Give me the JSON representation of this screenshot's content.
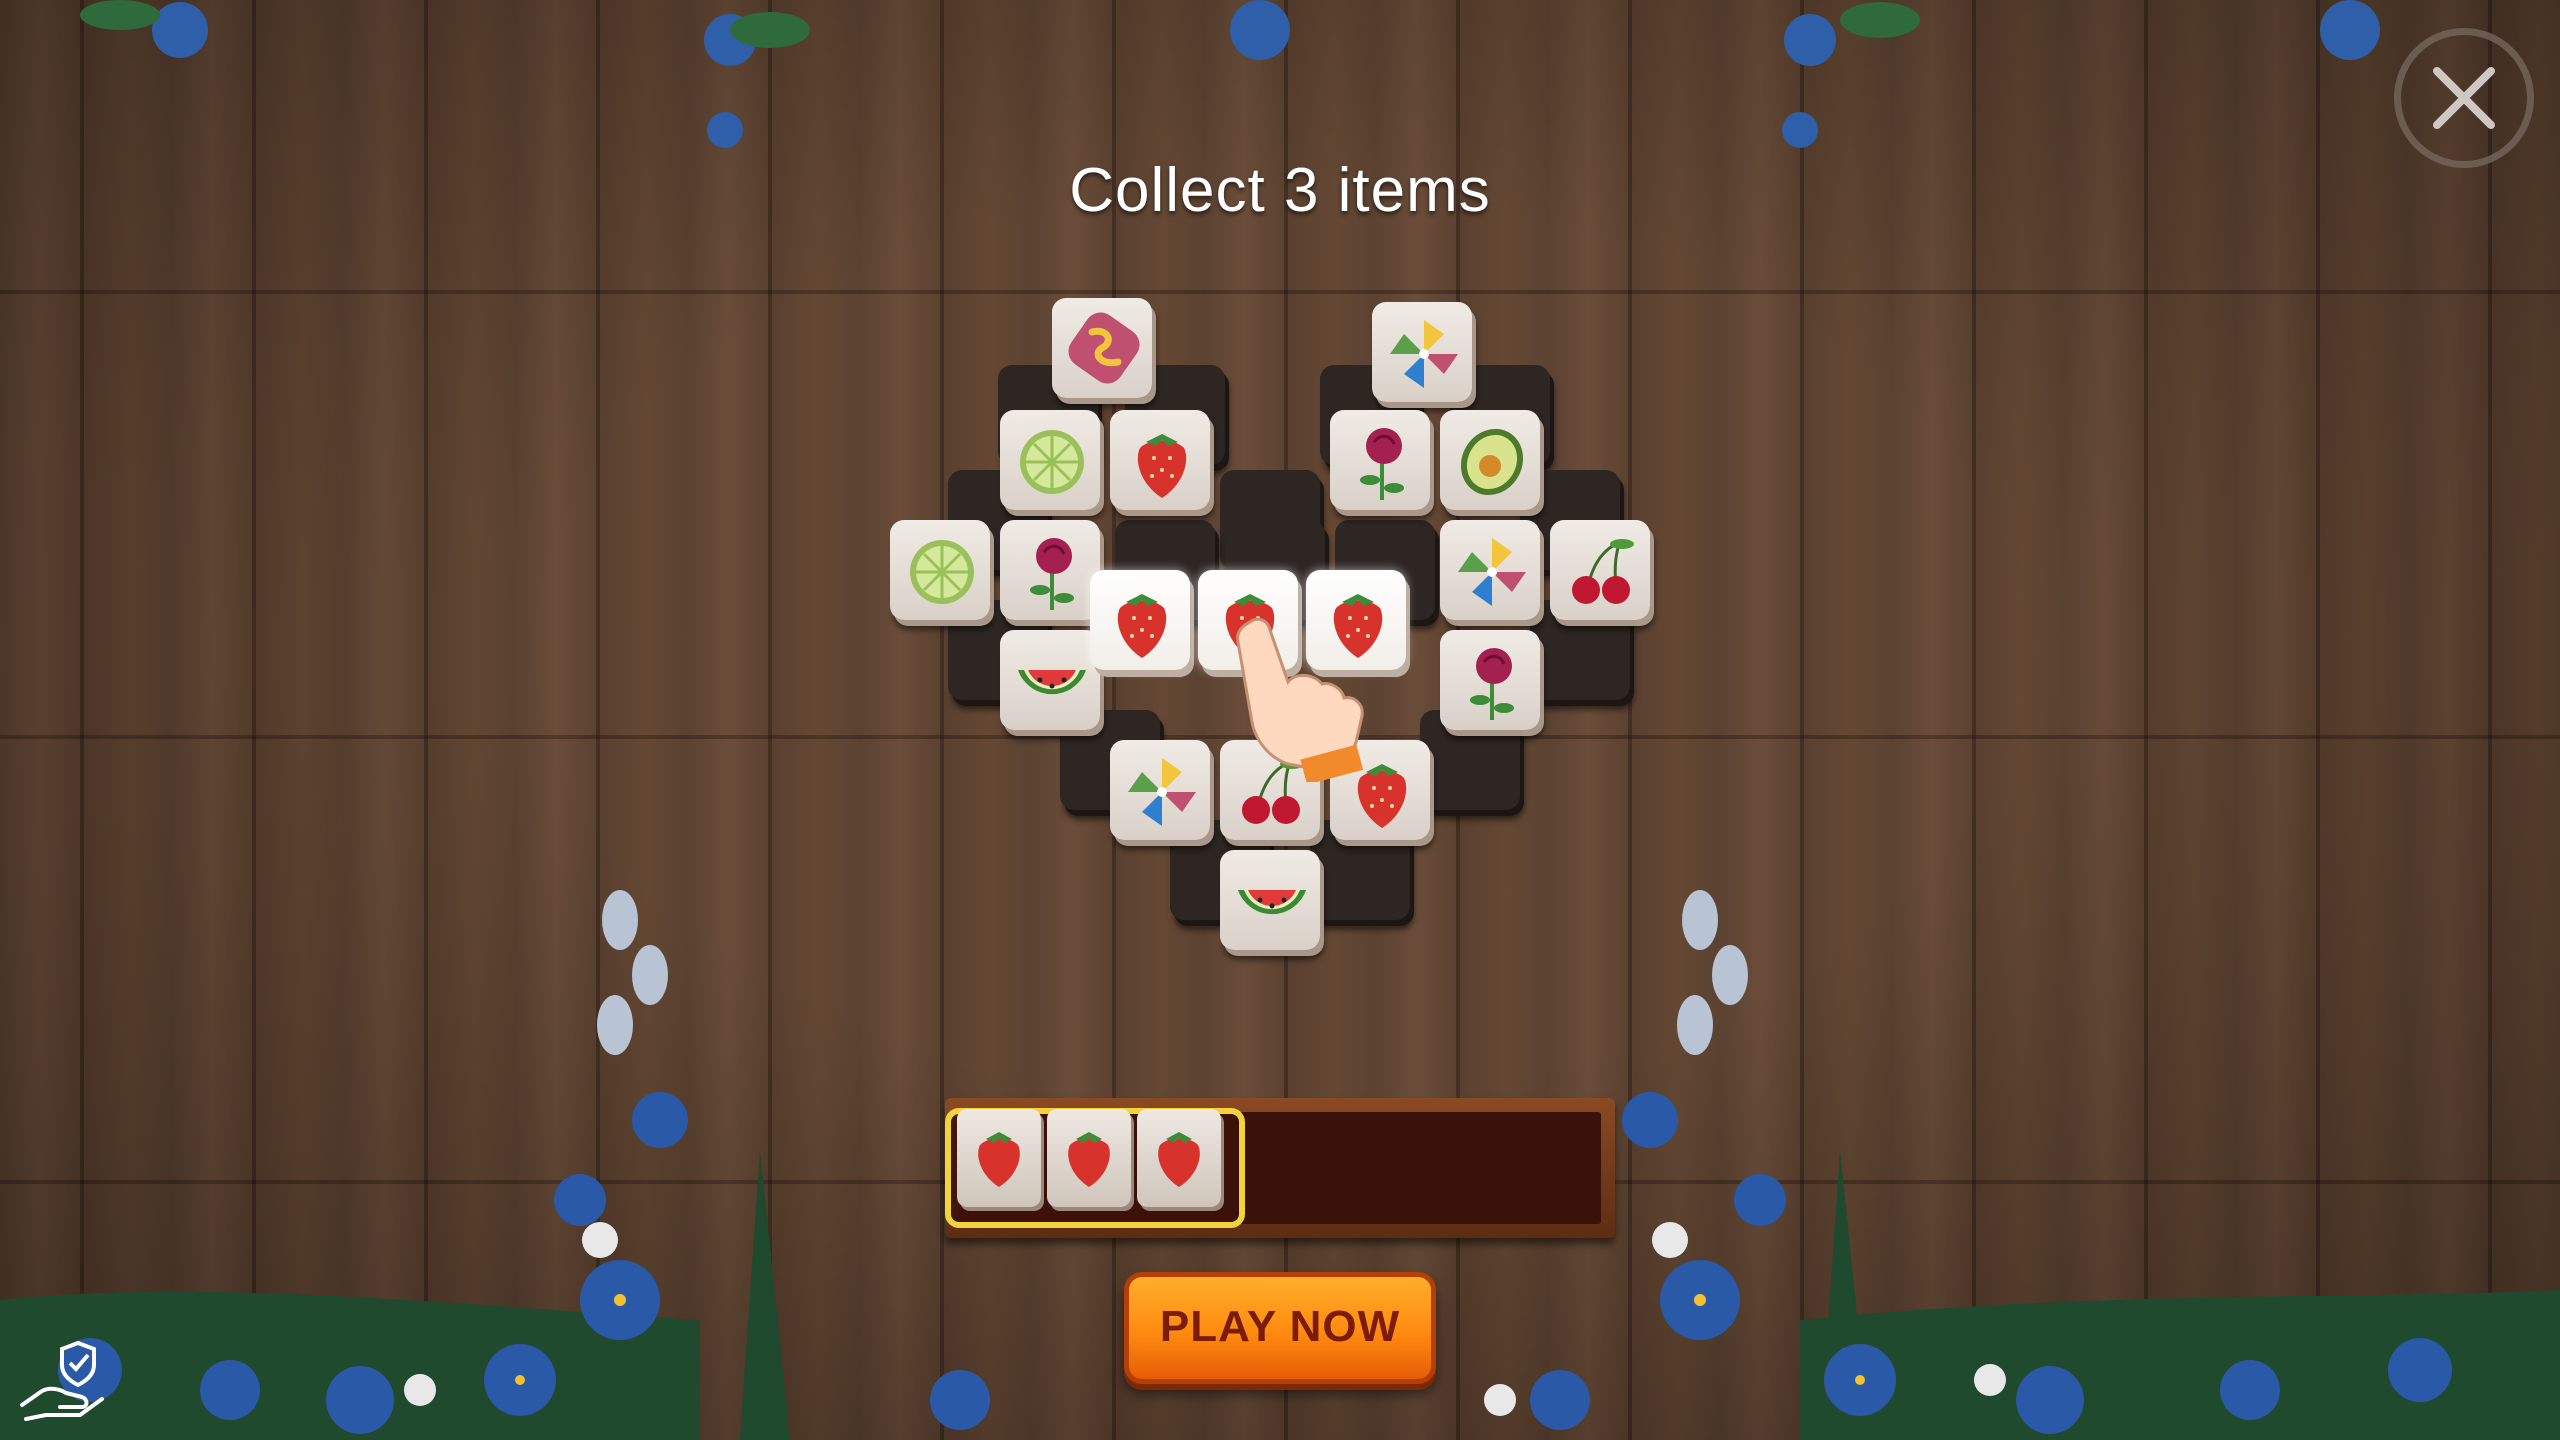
{
  "game": {
    "instruction": "Collect 3 items",
    "play_button_label": "PLAY NOW",
    "close_icon": "close-icon",
    "privacy_icon": "privacy-shield-hand-icon"
  },
  "board": {
    "selected_item": "strawberry",
    "tiles": [
      "worm",
      "pinwheel",
      "lime",
      "strawberry",
      "rose",
      "avocado",
      "lime",
      "rose",
      "strawberry",
      "strawberry",
      "strawberry",
      "pinwheel",
      "cherry",
      "watermelon",
      "rose",
      "pinwheel",
      "cherry",
      "strawberry",
      "watermelon"
    ]
  },
  "tray": {
    "capacity": 7,
    "collected": [
      "strawberry",
      "strawberry",
      "strawberry"
    ]
  },
  "colors": {
    "accent_button": "#ff8a10",
    "tray_highlight": "#f3d23a",
    "tray_frame": "#7a3d1a"
  }
}
